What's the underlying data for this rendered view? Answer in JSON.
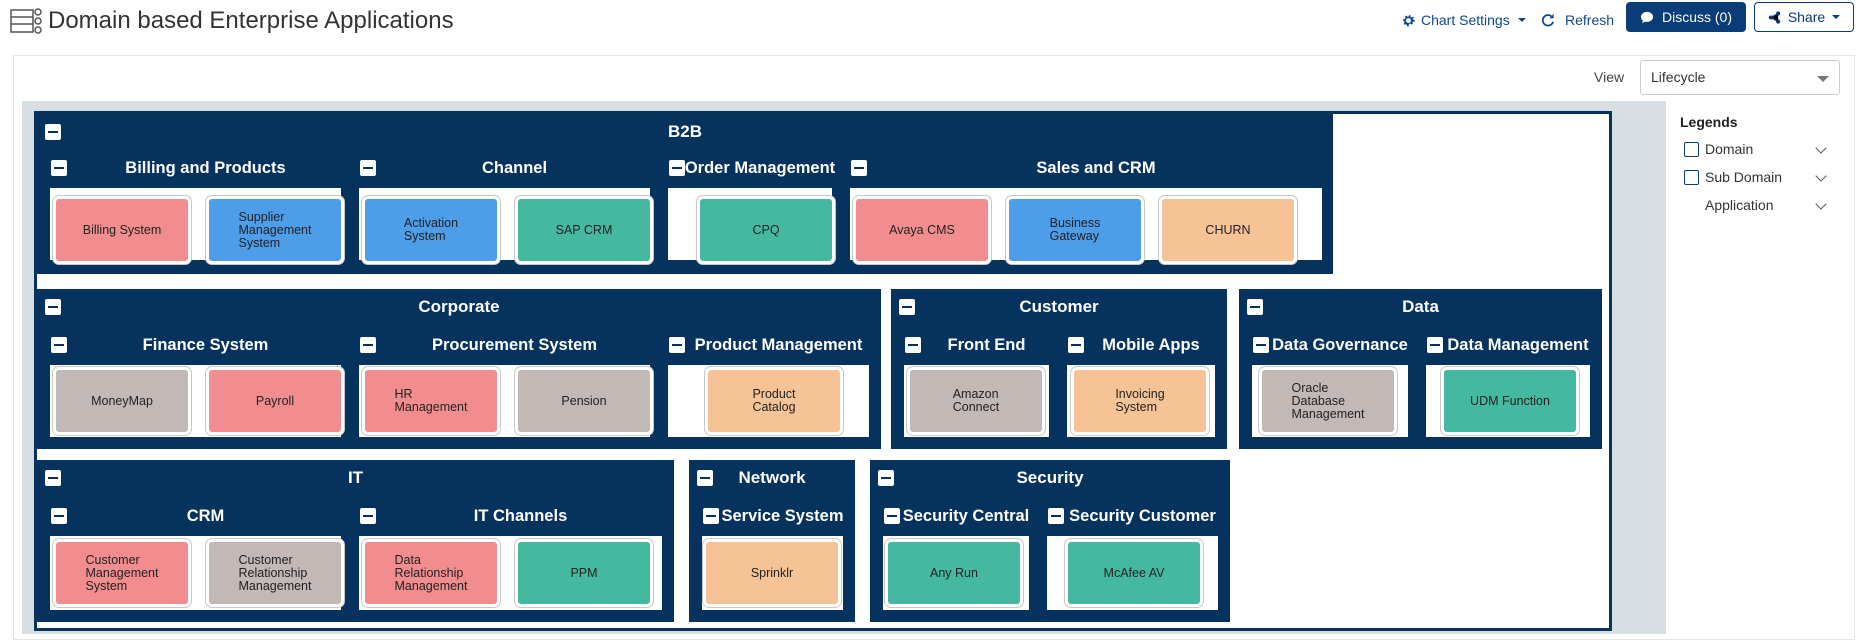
{
  "header": {
    "title": "Domain based Enterprise Applications",
    "chart_settings": "Chart Settings",
    "refresh": "Refresh",
    "discuss": "Discuss (0)",
    "share": "Share"
  },
  "view": {
    "label": "View",
    "selected": "Lifecycle"
  },
  "legend": {
    "title": "Legends",
    "items": [
      "Domain",
      "Sub Domain",
      "Application"
    ]
  },
  "domains": {
    "b2b": {
      "title": "B2B",
      "billing": {
        "title": "Billing and Products",
        "apps": [
          "Billing System",
          "Supplier\nManagement\nSystem"
        ]
      },
      "channel": {
        "title": "Channel",
        "apps": [
          "Activation\nSystem",
          "SAP CRM"
        ]
      },
      "order": {
        "title": "Order Management",
        "apps": [
          "CPQ"
        ]
      },
      "sales": {
        "title": "Sales and CRM",
        "apps": [
          "Avaya CMS",
          "Business\nGateway",
          "CHURN"
        ]
      }
    },
    "corporate": {
      "title": "Corporate",
      "finance": {
        "title": "Finance System",
        "apps": [
          "MoneyMap",
          "Payroll"
        ]
      },
      "procurement": {
        "title": "Procurement System",
        "apps": [
          "HR\nManagement",
          "Pension"
        ]
      },
      "product": {
        "title": "Product Management",
        "apps": [
          "Product\nCatalog"
        ]
      }
    },
    "customer": {
      "title": "Customer",
      "frontend": {
        "title": "Front End",
        "apps": [
          "Amazon\nConnect"
        ]
      },
      "mobile": {
        "title": "Mobile Apps",
        "apps": [
          "Invoicing\nSystem"
        ]
      }
    },
    "data": {
      "title": "Data",
      "governance": {
        "title": "Data Governance",
        "apps": [
          "Oracle\nDatabase\nManagement"
        ]
      },
      "management": {
        "title": "Data Management",
        "apps": [
          "UDM Function"
        ]
      }
    },
    "it": {
      "title": "IT",
      "crm": {
        "title": "CRM",
        "apps": [
          "Customer\nManagement\nSystem",
          "Customer\nRelationship\nManagement"
        ]
      },
      "channels": {
        "title": "IT Channels",
        "apps": [
          "Data\nRelationship\nManagement",
          "PPM"
        ]
      }
    },
    "network": {
      "title": "Network",
      "service": {
        "title": "Service System",
        "apps": [
          "Sprinklr"
        ]
      }
    },
    "security": {
      "title": "Security",
      "central": {
        "title": "Security Central",
        "apps": [
          "Any Run"
        ]
      },
      "customer": {
        "title": "Security Customer",
        "apps": [
          "McAfee AV"
        ]
      }
    }
  },
  "colors": {
    "domain": "#06325e",
    "pink": "#f28d8f",
    "blue": "#4e9de8",
    "green": "#45b99f",
    "peach": "#f6c396",
    "grey": "#c2b8b5"
  }
}
